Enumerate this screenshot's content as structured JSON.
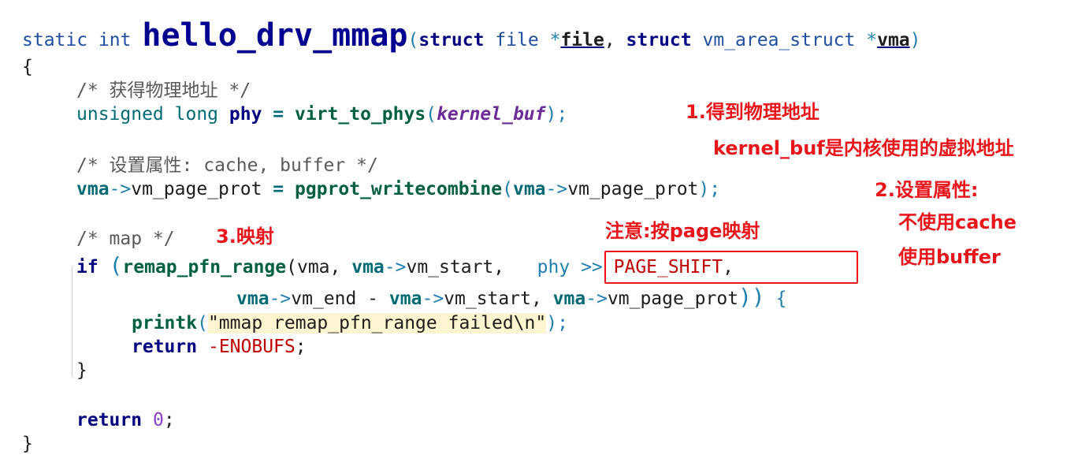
{
  "code": {
    "l1_static": "static",
    "l1_int": "int",
    "l1_func": "hello_drv_mmap",
    "l1_open": "(",
    "l1_struct1": "struct",
    "l1_file_t": "file",
    "l1_star1": "*",
    "l1_file": "file",
    "l1_comma": ",",
    "l1_struct2": "struct",
    "l1_vma_t": "vm_area_struct",
    "l1_star2": "*",
    "l1_vma": "vma",
    "l1_close": ")",
    "l2_brace": "{",
    "l3_comment": "/* 获得物理地址 */",
    "l4_unsigned": "unsigned long",
    "l4_phy": "phy",
    "l4_eq": "=",
    "l4_func": "virt_to_phys",
    "l4_open": "(",
    "l4_arg": "kernel_buf",
    "l4_close": ");",
    "l5_comment": "/* 设置属性: cache, buffer */",
    "l6_vma": "vma",
    "l6_arrow": "->",
    "l6_field": "vm_page_prot",
    "l6_eq": "=",
    "l6_func": "pgprot_writecombine",
    "l6_open": "(",
    "l6_vma2": "vma",
    "l6_arrow2": "->",
    "l6_field2": "vm_page_prot",
    "l6_close": ");",
    "l7_comment": "/* map */",
    "l8_if": "if",
    "l8_open": "(",
    "l8_func": "remap_pfn_range",
    "l8_args_a": "(vma, ",
    "l8_vma2": "vma",
    "l8_arrow": "->",
    "l8_field": "vm_start,",
    "l8_boxed_phy": "phy",
    "l8_boxed_shift": ">>",
    "l8_boxed_macro": "PAGE_SHIFT",
    "l8_boxed_comma": ",",
    "l9_vma": "vma",
    "l9_arrow": "->",
    "l9_end": "vm_end",
    "l9_minus": "-",
    "l9_vma2": "vma",
    "l9_arrow2": "->",
    "l9_start": "vm_start,",
    "l9_vma3": "vma",
    "l9_arrow3": "->",
    "l9_prot": "vm_page_prot",
    "l9_close": "))",
    "l9_brace": "{",
    "l10_printk": "printk",
    "l10_open": "(",
    "l10_str": "\"mmap remap_pfn_range failed\\n\"",
    "l10_close": ");",
    "l11_return": "return",
    "l11_minus": "-",
    "l11_macro": "ENOBUFS",
    "l11_semi": ";",
    "l12_brace": "}",
    "l13_return": "return",
    "l13_zero": "0",
    "l13_semi": ";",
    "l14_brace": "}"
  },
  "annotations": {
    "a1": "1.得到物理地址",
    "a2": "kernel_buf是内核使用的虚拟地址",
    "a3": "2.设置属性:",
    "a4": "不使用cache",
    "a5": "使用buffer",
    "a6": "注意:按page映射",
    "a7": "3.映射"
  },
  "colors": {
    "annotation": "#e8161b",
    "function_name": "#000090",
    "string_bg": "#fdf5cf"
  }
}
